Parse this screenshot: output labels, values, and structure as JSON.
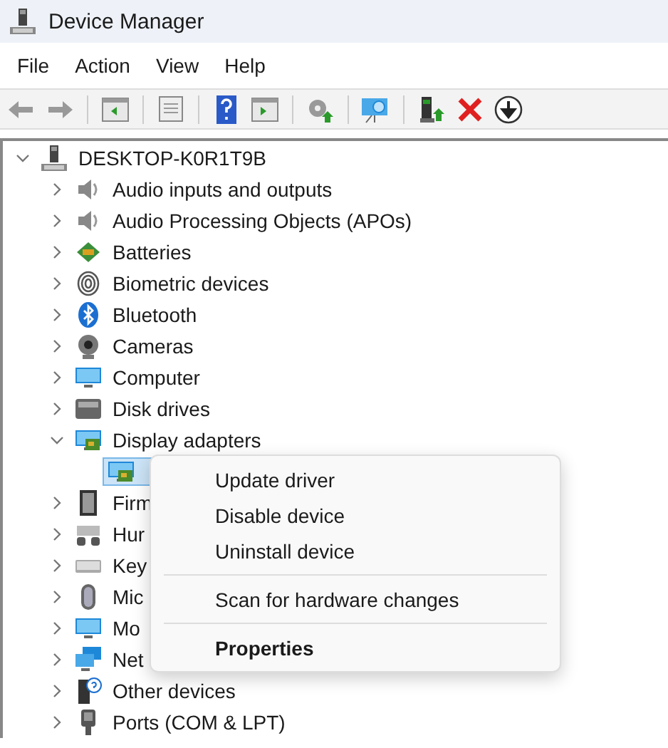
{
  "window": {
    "title": "Device Manager"
  },
  "menu_bar": [
    "File",
    "Action",
    "View",
    "Help"
  ],
  "tree": {
    "label": "DESKTOP-K0R1T9B",
    "expanded": true,
    "children": [
      {
        "label": "Audio inputs and outputs",
        "expanded": false
      },
      {
        "label": "Audio Processing Objects (APOs)",
        "expanded": false
      },
      {
        "label": "Batteries",
        "expanded": false
      },
      {
        "label": "Biometric devices",
        "expanded": false
      },
      {
        "label": "Bluetooth",
        "expanded": false
      },
      {
        "label": "Cameras",
        "expanded": false
      },
      {
        "label": "Computer",
        "expanded": false
      },
      {
        "label": "Disk drives",
        "expanded": false
      },
      {
        "label": "Display adapters",
        "expanded": true,
        "children": [
          {
            "selected": true
          }
        ]
      },
      {
        "label": "Firm",
        "expanded": false
      },
      {
        "label": "Hur",
        "expanded": false
      },
      {
        "label": "Key",
        "expanded": false
      },
      {
        "label": "Mic",
        "expanded": false
      },
      {
        "label": "Mo",
        "expanded": false
      },
      {
        "label": "Net",
        "expanded": false
      },
      {
        "label": "Other devices",
        "expanded": false
      },
      {
        "label": "Ports (COM & LPT)",
        "expanded": false
      }
    ]
  },
  "context_menu": [
    {
      "kind": "item",
      "label": "Update driver",
      "default": false
    },
    {
      "kind": "item",
      "label": "Disable device",
      "default": false
    },
    {
      "kind": "item",
      "label": "Uninstall device",
      "default": false
    },
    {
      "kind": "separator"
    },
    {
      "kind": "item",
      "label": "Scan for hardware changes",
      "default": false
    },
    {
      "kind": "separator"
    },
    {
      "kind": "item",
      "label": "Properties",
      "default": true
    }
  ]
}
